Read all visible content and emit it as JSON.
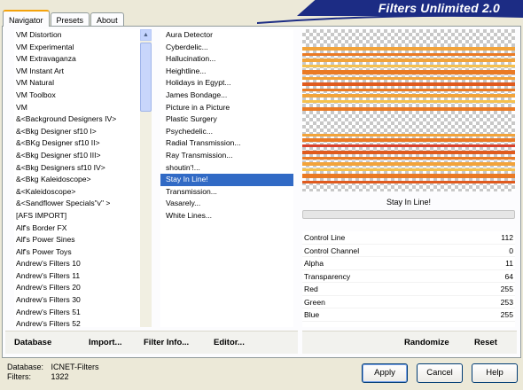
{
  "window": {
    "title": "Filters Unlimited 2.0",
    "tabs": [
      "Navigator",
      "Presets",
      "About"
    ],
    "active_tab": "Navigator"
  },
  "categories": {
    "items": [
      "VM Distortion",
      "VM Experimental",
      "VM Extravaganza",
      "VM Instant Art",
      "VM Natural",
      "VM Toolbox",
      "VM",
      "&<Background Designers IV>",
      "&<Bkg Designer sf10 I>",
      "&<BKg Designer sf10 II>",
      "&<Bkg Designer sf10 III>",
      "&<Bkg Designers sf10 IV>",
      "&<Bkg Kaleidoscope>",
      "&<Kaleidoscope>",
      "&<Sandflower Specials\"v\" >",
      "[AFS IMPORT]",
      "Alf's Border FX",
      "Alf's Power Sines",
      "Alf's Power Toys",
      "Andrew's Filters 10",
      "Andrew's Filters 11",
      "Andrew's Filters 20",
      "Andrew's Filters 30",
      "Andrew's Filters 51",
      "Andrew's Filters 52"
    ]
  },
  "filters": {
    "items": [
      "Aura Detector",
      "Cyberdelic...",
      "Hallucination...",
      "Heightline...",
      "Holidays in Egypt...",
      "James Bondage...",
      "Picture in a Picture",
      "Plastic Surgery",
      "Psychedelic...",
      "Radial Transmission...",
      "Ray Transmission...",
      "shoutin'!...",
      "Stay In Line!",
      "Transmission...",
      "Vasarely...",
      "White Lines..."
    ],
    "selected": "Stay In Line!"
  },
  "preview": {
    "label": "Stay In Line!",
    "stripe_colors": [
      "#f2a33a",
      "#ea7a24",
      "#e05a1e",
      "#f5c14e",
      "#d9402a"
    ]
  },
  "parameters": [
    {
      "name": "Control Line",
      "value": "112"
    },
    {
      "name": "Control Channel",
      "value": "0"
    },
    {
      "name": "Alpha",
      "value": "11"
    },
    {
      "name": "Transparency",
      "value": "64"
    },
    {
      "name": "Red",
      "value": "255"
    },
    {
      "name": "Green",
      "value": "253"
    },
    {
      "name": "Blue",
      "value": "255"
    }
  ],
  "toolbar": {
    "database": "Database",
    "import": "Import...",
    "filter_info": "Filter Info...",
    "editor": "Editor...",
    "randomize": "Randomize",
    "reset": "Reset"
  },
  "footer": {
    "database_label": "Database:",
    "database_value": "ICNET-Filters",
    "filters_label": "Filters:",
    "filters_value": "1322"
  },
  "buttons": {
    "apply": "Apply",
    "cancel": "Cancel",
    "help": "Help"
  }
}
